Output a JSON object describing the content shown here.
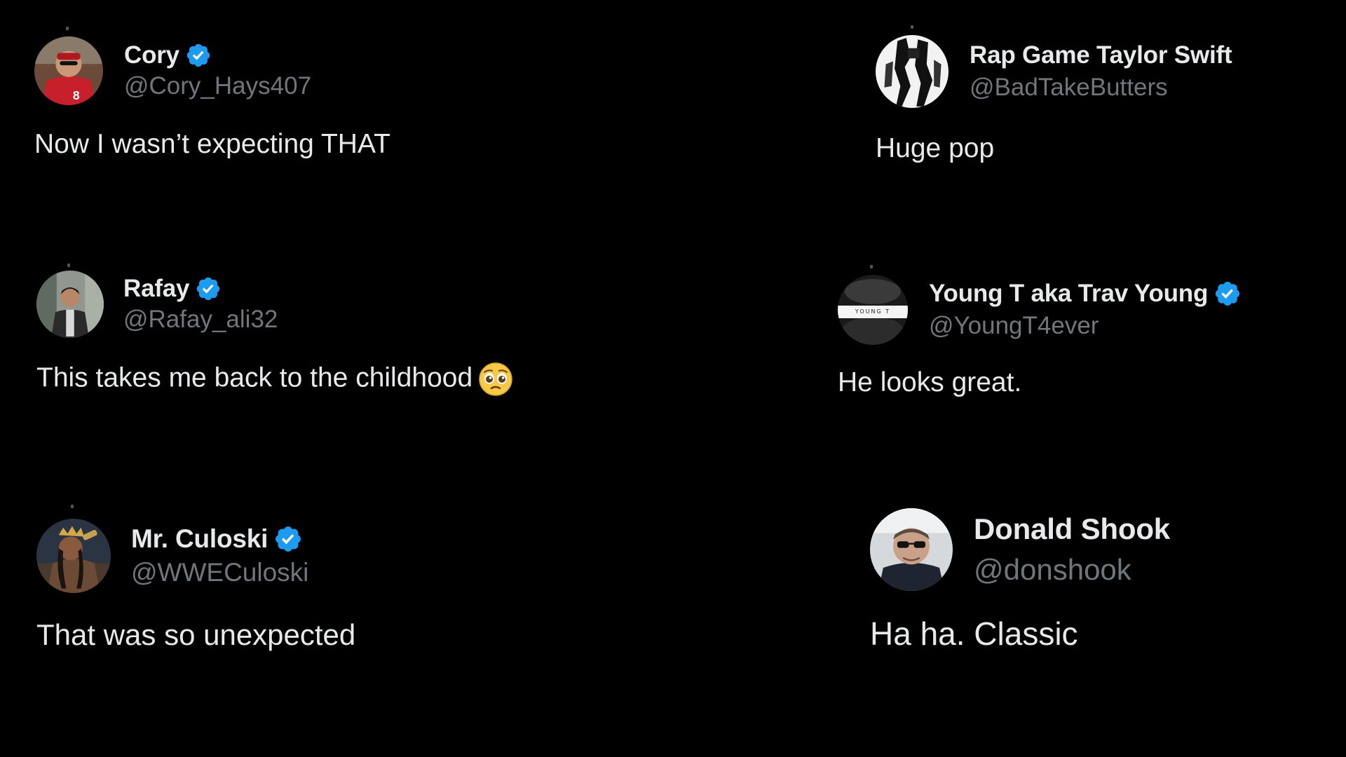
{
  "tweets": [
    {
      "display_name": "Cory",
      "handle": "@Cory_Hays407",
      "verified": true,
      "text": "Now I wasn’t expecting THAT",
      "avatar_icon": "avatar-red-jersey"
    },
    {
      "display_name": "Rap Game Taylor Swift",
      "handle": "@BadTakeButters",
      "verified": false,
      "text": "Huge pop",
      "avatar_icon": "avatar-black-white-figure"
    },
    {
      "display_name": "Rafay",
      "handle": "@Rafay_ali32",
      "verified": true,
      "text": "This takes me back to the childhood",
      "emoji": "pleading-face-emoji",
      "avatar_icon": "avatar-man-jacket"
    },
    {
      "display_name": "Young T aka Trav Young",
      "handle": "@YoungT4ever",
      "verified": true,
      "text": "He looks great.",
      "avatar_icon": "avatar-young-t-logo",
      "avatar_caption": "YOUNG T"
    },
    {
      "display_name": "Mr. Culoski",
      "handle": "@WWECuloski",
      "verified": true,
      "text": "That was so unexpected",
      "avatar_icon": "avatar-crowned-wrestler"
    },
    {
      "display_name": "Donald Shook",
      "handle": "@donshook",
      "verified": false,
      "text": "Ha ha. Classic",
      "avatar_icon": "avatar-man-sunglasses"
    }
  ],
  "colors": {
    "background": "#000000",
    "name": "#e7e9ea",
    "handle": "#71767b",
    "verified_badge": "#1d9bf0"
  }
}
